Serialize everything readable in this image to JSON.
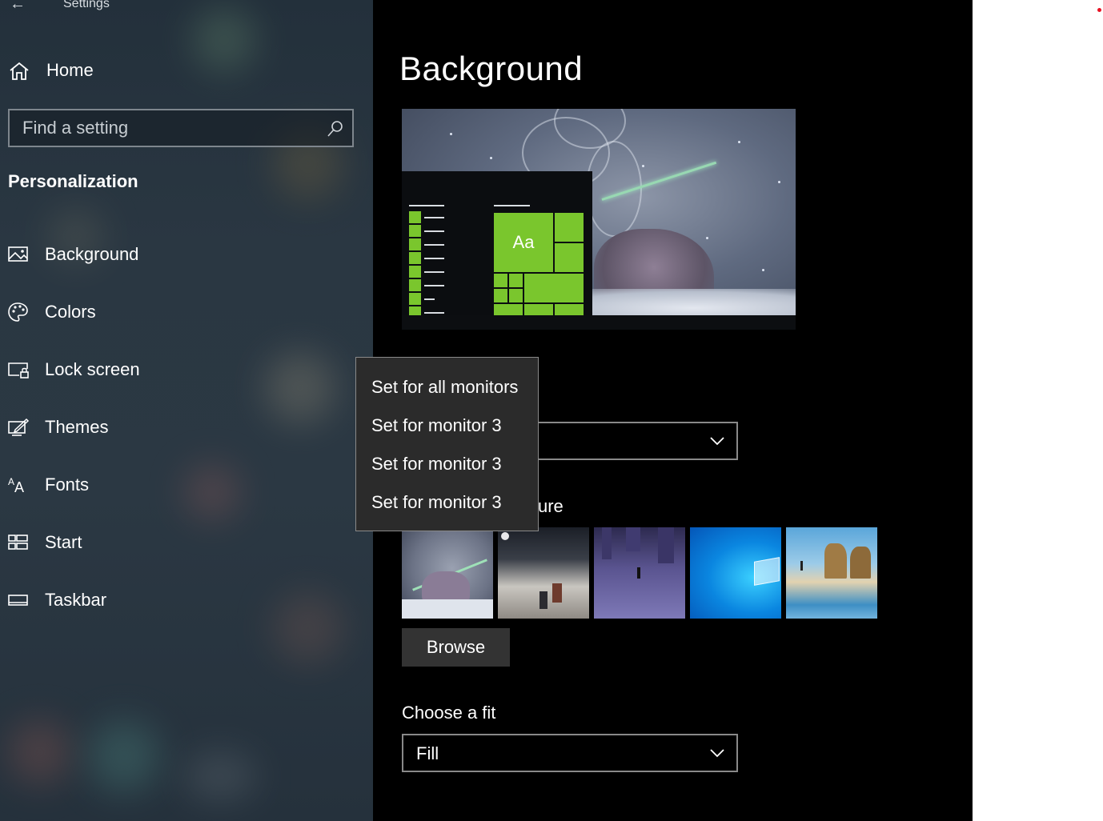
{
  "window": {
    "title": "Settings",
    "back_icon": "back-arrow-icon"
  },
  "sidebar": {
    "home_label": "Home",
    "search_placeholder": "Find a setting",
    "section_title": "Personalization",
    "items": [
      {
        "label": "Background",
        "icon": "picture-icon"
      },
      {
        "label": "Colors",
        "icon": "palette-icon"
      },
      {
        "label": "Lock screen",
        "icon": "lock-screen-icon"
      },
      {
        "label": "Themes",
        "icon": "themes-icon"
      },
      {
        "label": "Fonts",
        "icon": "fonts-icon"
      },
      {
        "label": "Start",
        "icon": "start-icon"
      },
      {
        "label": "Taskbar",
        "icon": "taskbar-icon"
      }
    ]
  },
  "main": {
    "page_title": "Background",
    "preview": {
      "tile_text": "Aa",
      "accent_color": "#7ac62d"
    },
    "choose_picture_label_visible": "ure",
    "browse_label": "Browse",
    "choose_fit_label": "Choose a fit",
    "fit_value": "Fill",
    "background_dropdown_value": "",
    "thumbnails": [
      "wallpaper-thumbnail-1",
      "wallpaper-thumbnail-2",
      "wallpaper-thumbnail-3",
      "wallpaper-thumbnail-4",
      "wallpaper-thumbnail-5"
    ]
  },
  "context_menu": {
    "items": [
      "Set for all monitors",
      "Set for monitor 3",
      "Set for monitor 3",
      "Set for monitor 3"
    ]
  },
  "colors": {
    "sidebar_bg": "#2a3742",
    "main_bg": "#000000",
    "accent": "#7ac62d",
    "menu_bg": "#2b2b2b",
    "notification_dot": "#e81123"
  }
}
